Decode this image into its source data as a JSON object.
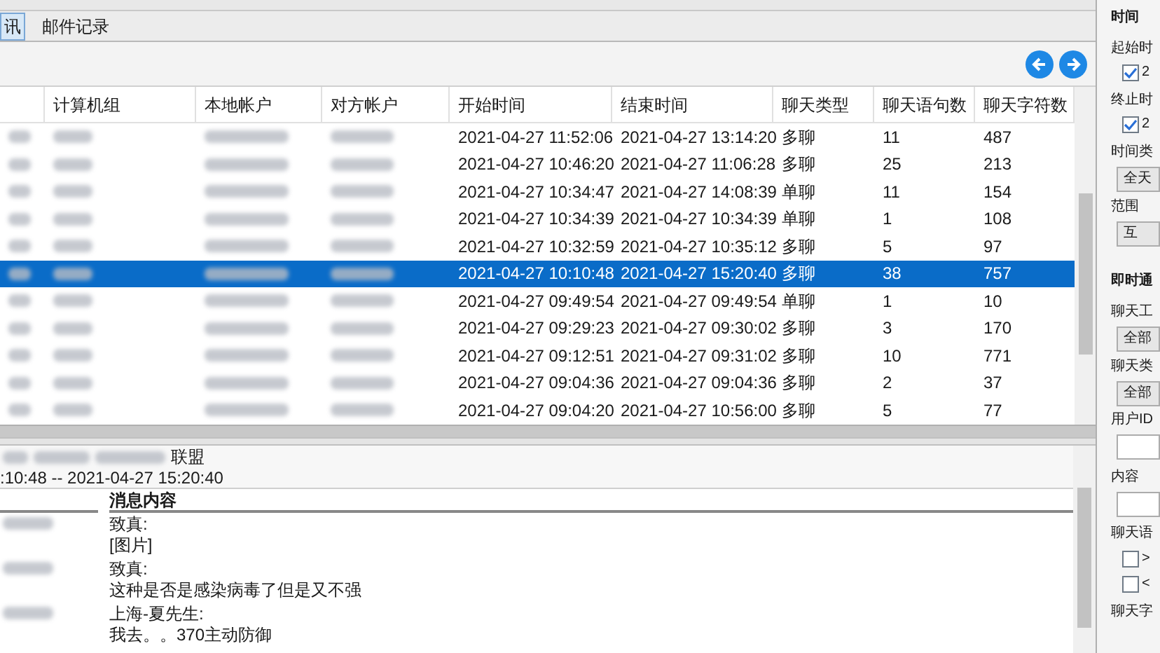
{
  "tabs": [
    {
      "label": "讯",
      "selected": true
    },
    {
      "label": "邮件记录",
      "selected": false
    }
  ],
  "table": {
    "columns": [
      "计算机组",
      "本地帐户",
      "对方帐户",
      "开始时间",
      "结束时间",
      "聊天类型",
      "聊天语句数",
      "聊天字符数"
    ],
    "rows": [
      {
        "selected": false,
        "start": "2021-04-27 11:52:06",
        "end": "2021-04-27 13:14:20",
        "type": "多聊",
        "sentences": "11",
        "chars": "487"
      },
      {
        "selected": false,
        "start": "2021-04-27 10:46:20",
        "end": "2021-04-27 11:06:28",
        "type": "多聊",
        "sentences": "25",
        "chars": "213"
      },
      {
        "selected": false,
        "start": "2021-04-27 10:34:47",
        "end": "2021-04-27 14:08:39",
        "type": "单聊",
        "sentences": "11",
        "chars": "154"
      },
      {
        "selected": false,
        "start": "2021-04-27 10:34:39",
        "end": "2021-04-27 10:34:39",
        "type": "单聊",
        "sentences": "1",
        "chars": "108"
      },
      {
        "selected": false,
        "start": "2021-04-27 10:32:59",
        "end": "2021-04-27 10:35:12",
        "type": "多聊",
        "sentences": "5",
        "chars": "97"
      },
      {
        "selected": true,
        "start": "2021-04-27 10:10:48",
        "end": "2021-04-27 15:20:40",
        "type": "多聊",
        "sentences": "38",
        "chars": "757"
      },
      {
        "selected": false,
        "start": "2021-04-27 09:49:54",
        "end": "2021-04-27 09:49:54",
        "type": "单聊",
        "sentences": "1",
        "chars": "10"
      },
      {
        "selected": false,
        "start": "2021-04-27 09:29:23",
        "end": "2021-04-27 09:30:02",
        "type": "多聊",
        "sentences": "3",
        "chars": "170"
      },
      {
        "selected": false,
        "start": "2021-04-27 09:12:51",
        "end": "2021-04-27 09:31:02",
        "type": "多聊",
        "sentences": "10",
        "chars": "771"
      },
      {
        "selected": false,
        "start": "2021-04-27 09:04:36",
        "end": "2021-04-27 09:04:36",
        "type": "多聊",
        "sentences": "2",
        "chars": "37"
      },
      {
        "selected": false,
        "start": "2021-04-27 09:04:20",
        "end": "2021-04-27 10:56:00",
        "type": "多聊",
        "sentences": "5",
        "chars": "77"
      }
    ]
  },
  "detail": {
    "title_suffix": "联盟",
    "time_range": ":10:48 -- 2021-04-27 15:20:40",
    "content_header": "消息内容",
    "messages": [
      {
        "sender": "致真:",
        "text": "[图片]"
      },
      {
        "sender": "致真:",
        "text": "这种是否是感染病毒了但是又不强"
      },
      {
        "sender": "上海-夏先生:",
        "text": "我去。。370主动防御"
      }
    ]
  },
  "filter_panel": {
    "time_header": "时间",
    "start_label": "起始时",
    "start_checked": true,
    "start_value": "2",
    "end_label": "终止时",
    "end_checked": true,
    "end_value": "2",
    "time_type_label": "时间类",
    "time_type_value": "全天",
    "range_label": "范围",
    "range_value": "互",
    "im_header": "即时通",
    "tool_label": "聊天工",
    "tool_value": "全部",
    "chat_type_label": "聊天类",
    "chat_type_value": "全部",
    "user_label": "用户ID",
    "content_label": "内容",
    "sentences_label": "聊天语",
    "sentence_filters": [
      {
        "op": ">",
        "checked": false
      },
      {
        "op": "<",
        "checked": false
      }
    ],
    "chars_label": "聊天字"
  }
}
